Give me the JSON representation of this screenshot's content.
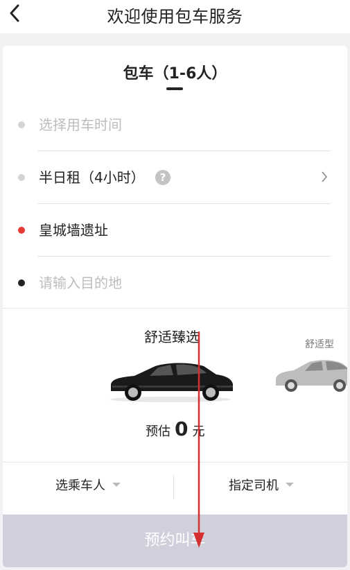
{
  "header": {
    "title": "欢迎使用包车服务"
  },
  "tabs": [
    {
      "label": "包车（1-6人）"
    }
  ],
  "form": {
    "time_placeholder": "选择用车时间",
    "duration": "半日租（4小时）",
    "help": "?",
    "pickup": "皇城墙遗址",
    "destination_placeholder": "请输入目的地"
  },
  "cars": [
    {
      "name": "舒适臻选"
    },
    {
      "name": "舒适型"
    }
  ],
  "price": {
    "prefix": "预估",
    "value": "0",
    "unit": "元"
  },
  "options": {
    "passenger": "选乘车人",
    "driver": "指定司机"
  },
  "submit": {
    "label": "预约叫车"
  },
  "colors": {
    "pickup_dot": "#e53935",
    "dest_dot": "#222222",
    "button_bg": "#cfd0dc",
    "arrow": "#d32f2f"
  }
}
